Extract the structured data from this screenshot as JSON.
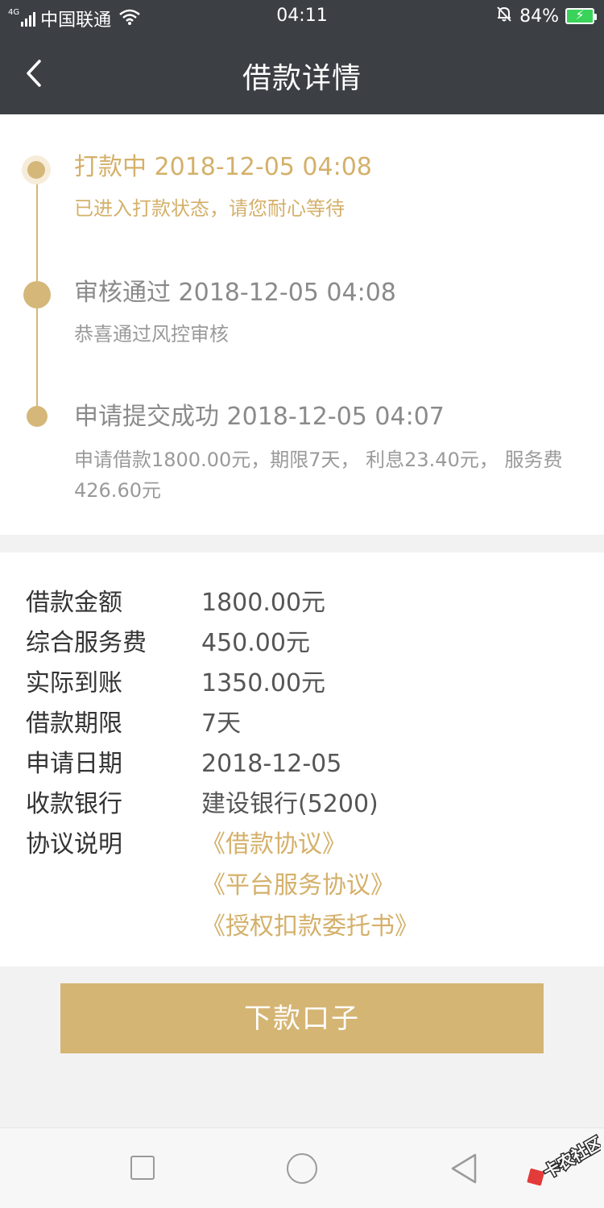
{
  "status_bar": {
    "network": "4G",
    "carrier": "中国联通",
    "time": "04:11",
    "battery": "84%"
  },
  "header": {
    "title": "借款详情"
  },
  "timeline": [
    {
      "title": "打款中 2018-12-05 04:08",
      "desc": "已进入打款状态，请您耐心等待",
      "state": "active"
    },
    {
      "title": "审核通过 2018-12-05 04:08",
      "desc": "恭喜通过风控审核",
      "state": "done"
    },
    {
      "title": "申请提交成功 2018-12-05 04:07",
      "desc_line1": "申请借款1800.00元，期限7天， 利息23.40元， 服务费",
      "desc_line2": "426.60元",
      "state": "done"
    }
  ],
  "details": [
    {
      "label": "借款金额",
      "value": "1800.00元"
    },
    {
      "label": "综合服务费",
      "value": "450.00元"
    },
    {
      "label": "实际到账",
      "value": "1350.00元"
    },
    {
      "label": "借款期限",
      "value": "7天"
    },
    {
      "label": "申请日期",
      "value": "2018-12-05"
    },
    {
      "label": "收款银行",
      "value": "建设银行(5200)"
    },
    {
      "label": "协议说明",
      "value": ""
    }
  ],
  "agreements": [
    "《借款协议》",
    "《平台服务协议》",
    "《授权扣款委托书》"
  ],
  "action_button": {
    "label": "下款口子"
  },
  "watermark": {
    "text": "卡农社区"
  },
  "colors": {
    "header_bg": "#3c4045",
    "accent_gold": "#d4b779",
    "button_gold": "#d5b574"
  }
}
